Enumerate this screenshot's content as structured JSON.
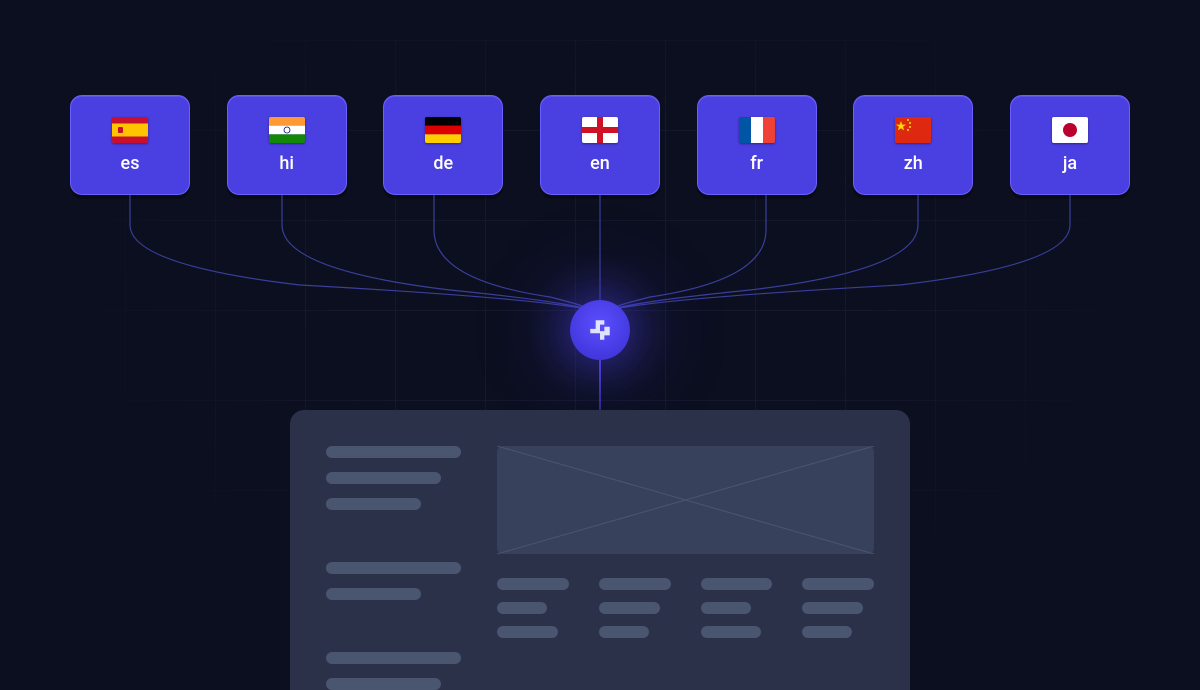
{
  "languages": [
    {
      "code": "es",
      "flag": "spain"
    },
    {
      "code": "hi",
      "flag": "india"
    },
    {
      "code": "de",
      "flag": "germany"
    },
    {
      "code": "en",
      "flag": "england"
    },
    {
      "code": "fr",
      "flag": "france"
    },
    {
      "code": "zh",
      "flag": "china"
    },
    {
      "code": "ja",
      "flag": "japan"
    }
  ],
  "hub": {
    "icon": "logo-glyph"
  },
  "colors": {
    "background": "#0c0f1f",
    "card": "#4a3fe0",
    "card_border": "#6a5fff",
    "wireframe_bg": "#2a3148",
    "wireframe_line": "#4a5570"
  }
}
